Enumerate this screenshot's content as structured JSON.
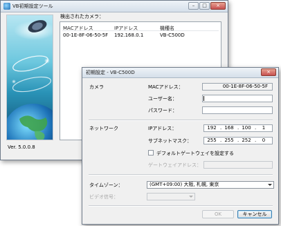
{
  "main": {
    "title": "VB初期設定ツール",
    "detected_label": "検出されたカメラ：",
    "columns": [
      "MACアドレス",
      "IPアドレス",
      "機種名"
    ],
    "rows": [
      [
        "00-1E-8F-06-50-5F",
        "192.168.0.1",
        "VB-C500D"
      ]
    ],
    "version": "Ver. 5.0.0.8",
    "window_buttons": [
      "–",
      "□",
      "×"
    ]
  },
  "dialog": {
    "title": "初期設定 - VB-C500D",
    "camera_section": "カメラ",
    "mac_label": "MACアドレス：",
    "mac_value": "00-1E-8F-06-50-5F",
    "username_label": "ユーザー名：",
    "username_value": "",
    "password_label": "パスワード：",
    "password_value": "",
    "network_section": "ネットワーク",
    "ip_label": "IPアドレス：",
    "ip_octets": [
      "192",
      "168",
      "100",
      "1"
    ],
    "subnet_label": "サブネットマスク：",
    "subnet_octets": [
      "255",
      "255",
      "252",
      "0"
    ],
    "gateway_checkbox_label": "デフォルトゲートウェイを設定する",
    "gateway_checked": false,
    "gateway_label": "ゲートウェイアドレス：",
    "timezone_label": "タイムゾーン：",
    "timezone_value": "(GMT+09:00) 大阪, 札幌, 東京",
    "video_signal_label": "ビデオ信号：",
    "video_signal_value": "",
    "ok_label": "OK",
    "cancel_label": "キャンセル",
    "window_buttons": [
      "×"
    ]
  }
}
